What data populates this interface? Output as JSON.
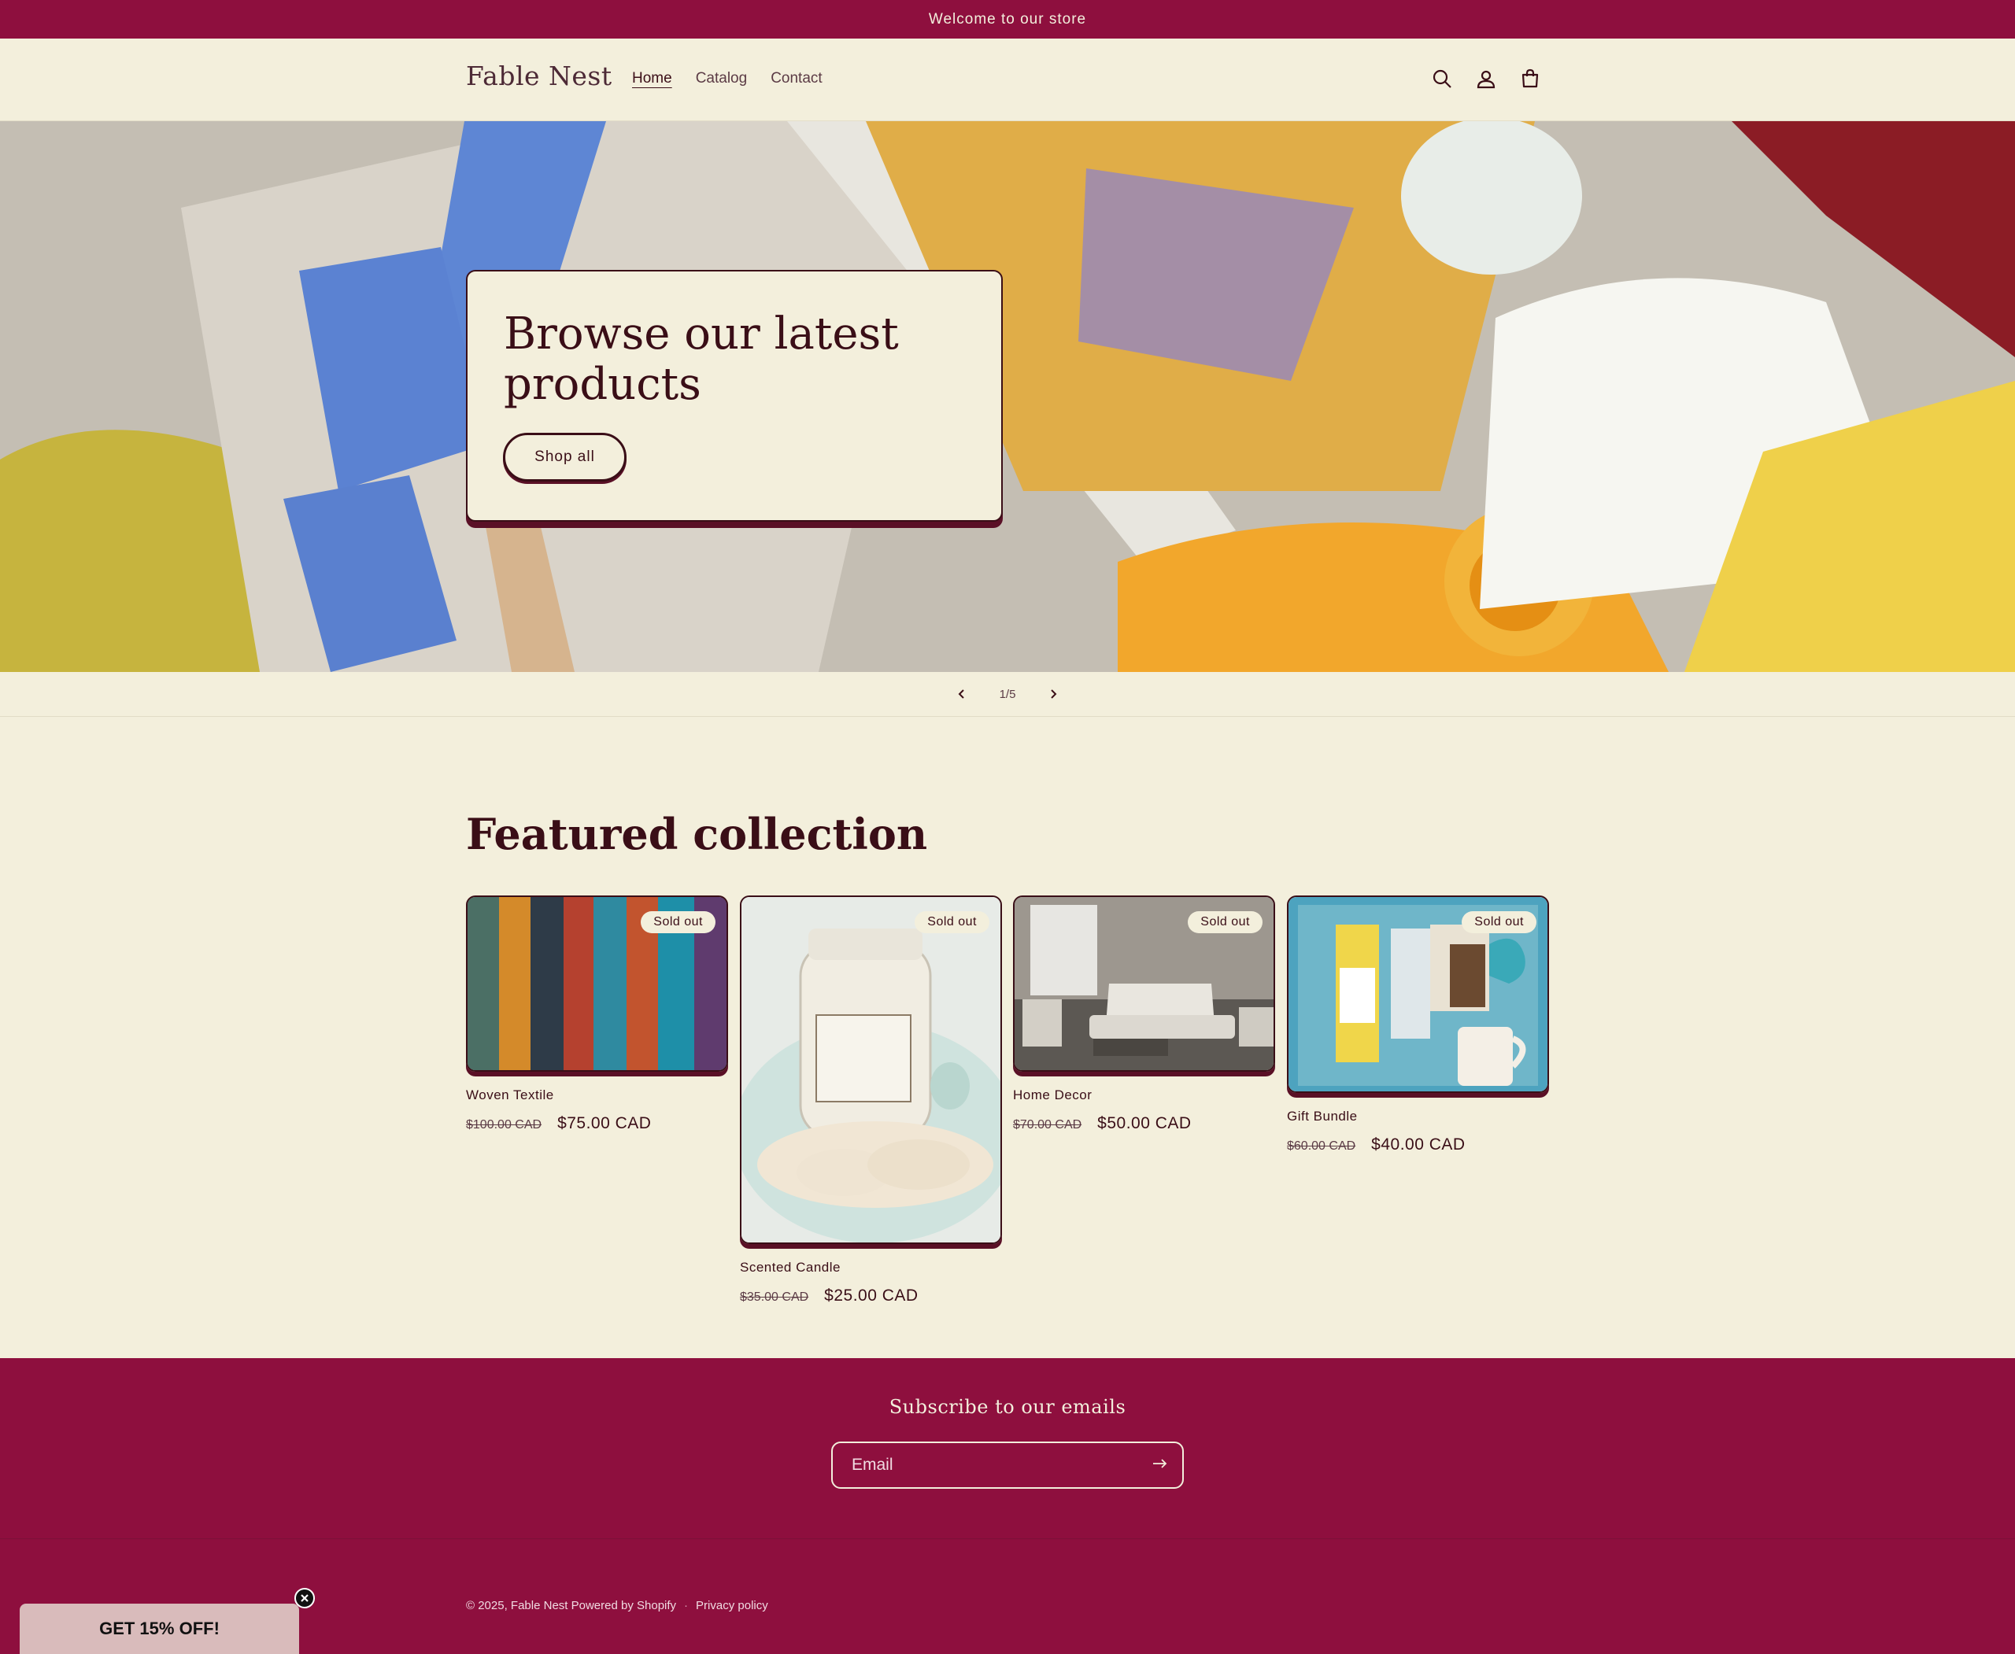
{
  "announcement": {
    "text": "Welcome to our store"
  },
  "header": {
    "logo": "Fable Nest",
    "nav": [
      {
        "label": "Home",
        "active": true
      },
      {
        "label": "Catalog",
        "active": false
      },
      {
        "label": "Contact",
        "active": false
      }
    ],
    "icons": [
      "search-icon",
      "account-icon",
      "cart-icon"
    ]
  },
  "hero": {
    "title": "Browse our latest products",
    "button_label": "Shop all",
    "slide_counter": "1/5"
  },
  "featured": {
    "title": "Featured collection",
    "products": [
      {
        "name": "Woven Textile",
        "old_price": "$100.00 CAD",
        "price": "$75.00 CAD",
        "badge": "Sold out"
      },
      {
        "name": "Scented Candle",
        "old_price": "$35.00 CAD",
        "price": "$25.00 CAD",
        "badge": "Sold out"
      },
      {
        "name": "Home Decor",
        "old_price": "$70.00 CAD",
        "price": "$50.00 CAD",
        "badge": "Sold out"
      },
      {
        "name": "Gift Bundle",
        "old_price": "$60.00 CAD",
        "price": "$40.00 CAD",
        "badge": "Sold out"
      }
    ]
  },
  "subscribe": {
    "title": "Subscribe to our emails",
    "email_placeholder": "Email"
  },
  "footer": {
    "copyright": "© 2025, Fable Nest Powered by Shopify",
    "separator": "·",
    "privacy": "Privacy policy"
  },
  "promo": {
    "label": "GET 15% OFF!"
  },
  "colors": {
    "brand": "#8e0f3e",
    "background": "#f3efdc",
    "text": "#3a0e17"
  }
}
